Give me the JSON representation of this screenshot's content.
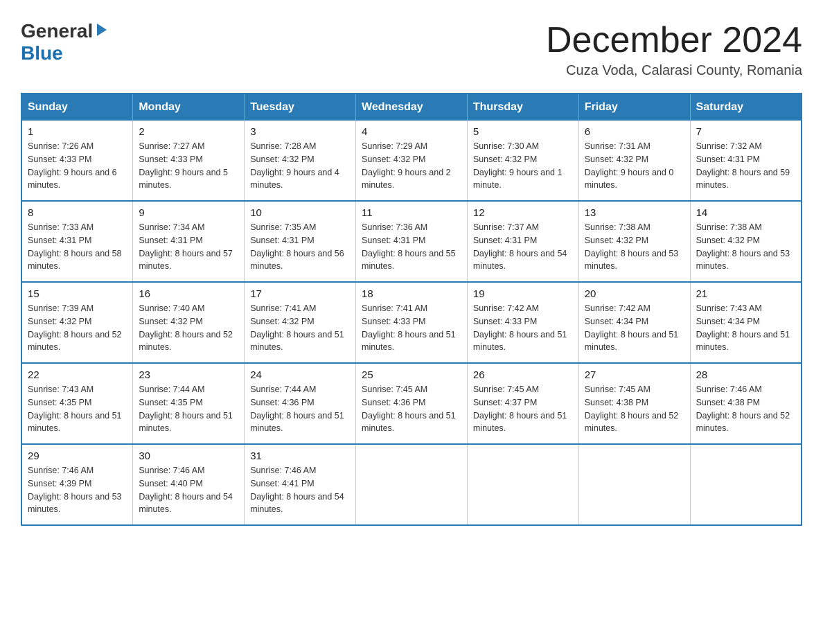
{
  "logo": {
    "general": "General",
    "triangle": "▶",
    "blue": "Blue"
  },
  "header": {
    "month_title": "December 2024",
    "subtitle": "Cuza Voda, Calarasi County, Romania"
  },
  "days_of_week": [
    "Sunday",
    "Monday",
    "Tuesday",
    "Wednesday",
    "Thursday",
    "Friday",
    "Saturday"
  ],
  "weeks": [
    [
      {
        "day": "1",
        "sunrise": "Sunrise: 7:26 AM",
        "sunset": "Sunset: 4:33 PM",
        "daylight": "Daylight: 9 hours and 6 minutes."
      },
      {
        "day": "2",
        "sunrise": "Sunrise: 7:27 AM",
        "sunset": "Sunset: 4:33 PM",
        "daylight": "Daylight: 9 hours and 5 minutes."
      },
      {
        "day": "3",
        "sunrise": "Sunrise: 7:28 AM",
        "sunset": "Sunset: 4:32 PM",
        "daylight": "Daylight: 9 hours and 4 minutes."
      },
      {
        "day": "4",
        "sunrise": "Sunrise: 7:29 AM",
        "sunset": "Sunset: 4:32 PM",
        "daylight": "Daylight: 9 hours and 2 minutes."
      },
      {
        "day": "5",
        "sunrise": "Sunrise: 7:30 AM",
        "sunset": "Sunset: 4:32 PM",
        "daylight": "Daylight: 9 hours and 1 minute."
      },
      {
        "day": "6",
        "sunrise": "Sunrise: 7:31 AM",
        "sunset": "Sunset: 4:32 PM",
        "daylight": "Daylight: 9 hours and 0 minutes."
      },
      {
        "day": "7",
        "sunrise": "Sunrise: 7:32 AM",
        "sunset": "Sunset: 4:31 PM",
        "daylight": "Daylight: 8 hours and 59 minutes."
      }
    ],
    [
      {
        "day": "8",
        "sunrise": "Sunrise: 7:33 AM",
        "sunset": "Sunset: 4:31 PM",
        "daylight": "Daylight: 8 hours and 58 minutes."
      },
      {
        "day": "9",
        "sunrise": "Sunrise: 7:34 AM",
        "sunset": "Sunset: 4:31 PM",
        "daylight": "Daylight: 8 hours and 57 minutes."
      },
      {
        "day": "10",
        "sunrise": "Sunrise: 7:35 AM",
        "sunset": "Sunset: 4:31 PM",
        "daylight": "Daylight: 8 hours and 56 minutes."
      },
      {
        "day": "11",
        "sunrise": "Sunrise: 7:36 AM",
        "sunset": "Sunset: 4:31 PM",
        "daylight": "Daylight: 8 hours and 55 minutes."
      },
      {
        "day": "12",
        "sunrise": "Sunrise: 7:37 AM",
        "sunset": "Sunset: 4:31 PM",
        "daylight": "Daylight: 8 hours and 54 minutes."
      },
      {
        "day": "13",
        "sunrise": "Sunrise: 7:38 AM",
        "sunset": "Sunset: 4:32 PM",
        "daylight": "Daylight: 8 hours and 53 minutes."
      },
      {
        "day": "14",
        "sunrise": "Sunrise: 7:38 AM",
        "sunset": "Sunset: 4:32 PM",
        "daylight": "Daylight: 8 hours and 53 minutes."
      }
    ],
    [
      {
        "day": "15",
        "sunrise": "Sunrise: 7:39 AM",
        "sunset": "Sunset: 4:32 PM",
        "daylight": "Daylight: 8 hours and 52 minutes."
      },
      {
        "day": "16",
        "sunrise": "Sunrise: 7:40 AM",
        "sunset": "Sunset: 4:32 PM",
        "daylight": "Daylight: 8 hours and 52 minutes."
      },
      {
        "day": "17",
        "sunrise": "Sunrise: 7:41 AM",
        "sunset": "Sunset: 4:32 PM",
        "daylight": "Daylight: 8 hours and 51 minutes."
      },
      {
        "day": "18",
        "sunrise": "Sunrise: 7:41 AM",
        "sunset": "Sunset: 4:33 PM",
        "daylight": "Daylight: 8 hours and 51 minutes."
      },
      {
        "day": "19",
        "sunrise": "Sunrise: 7:42 AM",
        "sunset": "Sunset: 4:33 PM",
        "daylight": "Daylight: 8 hours and 51 minutes."
      },
      {
        "day": "20",
        "sunrise": "Sunrise: 7:42 AM",
        "sunset": "Sunset: 4:34 PM",
        "daylight": "Daylight: 8 hours and 51 minutes."
      },
      {
        "day": "21",
        "sunrise": "Sunrise: 7:43 AM",
        "sunset": "Sunset: 4:34 PM",
        "daylight": "Daylight: 8 hours and 51 minutes."
      }
    ],
    [
      {
        "day": "22",
        "sunrise": "Sunrise: 7:43 AM",
        "sunset": "Sunset: 4:35 PM",
        "daylight": "Daylight: 8 hours and 51 minutes."
      },
      {
        "day": "23",
        "sunrise": "Sunrise: 7:44 AM",
        "sunset": "Sunset: 4:35 PM",
        "daylight": "Daylight: 8 hours and 51 minutes."
      },
      {
        "day": "24",
        "sunrise": "Sunrise: 7:44 AM",
        "sunset": "Sunset: 4:36 PM",
        "daylight": "Daylight: 8 hours and 51 minutes."
      },
      {
        "day": "25",
        "sunrise": "Sunrise: 7:45 AM",
        "sunset": "Sunset: 4:36 PM",
        "daylight": "Daylight: 8 hours and 51 minutes."
      },
      {
        "day": "26",
        "sunrise": "Sunrise: 7:45 AM",
        "sunset": "Sunset: 4:37 PM",
        "daylight": "Daylight: 8 hours and 51 minutes."
      },
      {
        "day": "27",
        "sunrise": "Sunrise: 7:45 AM",
        "sunset": "Sunset: 4:38 PM",
        "daylight": "Daylight: 8 hours and 52 minutes."
      },
      {
        "day": "28",
        "sunrise": "Sunrise: 7:46 AM",
        "sunset": "Sunset: 4:38 PM",
        "daylight": "Daylight: 8 hours and 52 minutes."
      }
    ],
    [
      {
        "day": "29",
        "sunrise": "Sunrise: 7:46 AM",
        "sunset": "Sunset: 4:39 PM",
        "daylight": "Daylight: 8 hours and 53 minutes."
      },
      {
        "day": "30",
        "sunrise": "Sunrise: 7:46 AM",
        "sunset": "Sunset: 4:40 PM",
        "daylight": "Daylight: 8 hours and 54 minutes."
      },
      {
        "day": "31",
        "sunrise": "Sunrise: 7:46 AM",
        "sunset": "Sunset: 4:41 PM",
        "daylight": "Daylight: 8 hours and 54 minutes."
      },
      null,
      null,
      null,
      null
    ]
  ]
}
